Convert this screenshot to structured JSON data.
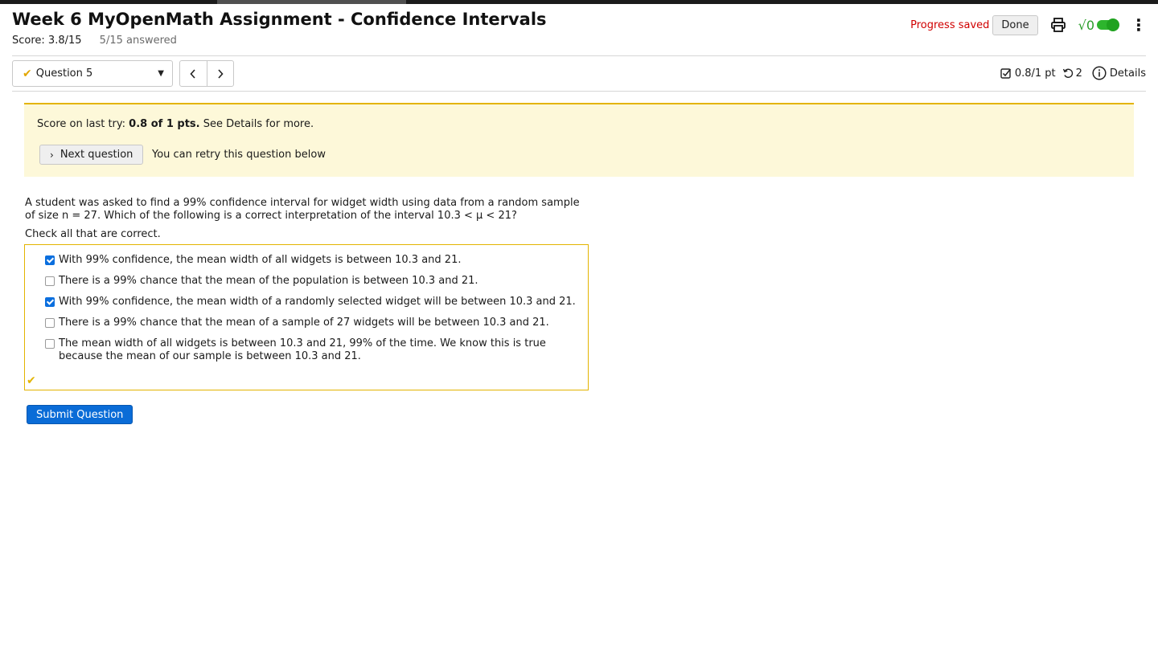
{
  "header": {
    "title": "Week 6 MyOpenMath Assignment - Confidence Intervals",
    "score": "Score: 3.8/15",
    "answered": "5/15 answered",
    "progress_saved": "Progress saved",
    "done_label": "Done",
    "math_toggle_label": "√0"
  },
  "question_nav": {
    "selected": "Question 5",
    "prev_icon": "chevron-left-icon",
    "next_icon": "chevron-right-icon"
  },
  "question_info": {
    "points": "0.8/1 pt",
    "tries": "2",
    "details_label": "Details"
  },
  "banner": {
    "score_prefix": "Score on last try: ",
    "score_bold": "0.8 of 1 pts.",
    "score_suffix": " See Details for more.",
    "next_button": "Next question",
    "retry_text": "You can retry this question below"
  },
  "question": {
    "prompt": "A student was asked to find a 99% confidence interval for widget width using data from a random sample of size n = 27. Which of the following is a correct interpretation of the interval 10.3 < μ < 21?",
    "instruction": "Check all that are correct.",
    "choices": [
      {
        "label": "With 99% confidence, the mean width of all widgets is between 10.3 and 21.",
        "checked": true
      },
      {
        "label": "There is a 99% chance that the mean of the population is between 10.3 and 21.",
        "checked": false
      },
      {
        "label": "With 99% confidence, the mean width of a randomly selected widget will be between 10.3 and 21.",
        "checked": true
      },
      {
        "label": "There is a 99% chance that the mean of a sample of 27 widgets will be between 10.3 and 21.",
        "checked": false
      },
      {
        "label": "The mean width of all widgets is between 10.3 and 21, 99% of the time. We know this is true because the mean of our sample is between 10.3 and 21.",
        "checked": false
      }
    ]
  },
  "submit_label": "Submit Question",
  "colors": {
    "accent_blue": "#0a6cd7",
    "banner_bg": "#fdf8d9",
    "partial_gold": "#e3b400",
    "saved_red": "#d00000",
    "toggle_green": "#2db52d"
  }
}
